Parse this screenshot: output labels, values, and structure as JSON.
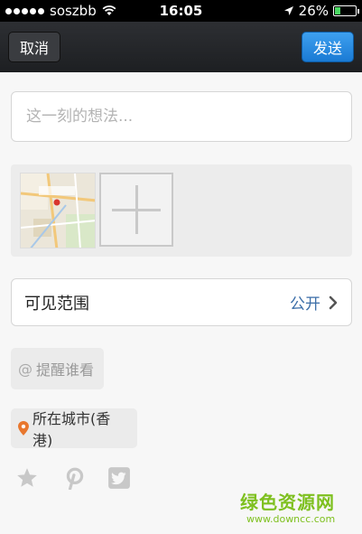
{
  "status_bar": {
    "carrier": "soszbb",
    "time": "16:05",
    "battery": "26%",
    "battery_level": 0.26,
    "battery_color": "#4cd964"
  },
  "nav": {
    "cancel_label": "取消",
    "send_label": "发送",
    "send_color": "#1a7ad4"
  },
  "compose": {
    "placeholder": "这一刻的想法..."
  },
  "photos": {
    "add_icon": "plus-icon",
    "map_icon": "map-thumbnail"
  },
  "visibility": {
    "label": "可见范围",
    "value": "公开",
    "icon": "chevron-right-icon"
  },
  "remind": {
    "icon": "at-icon",
    "label": "提醒谁看"
  },
  "location": {
    "icon": "location-pin-icon",
    "label": "所在城市(香港)",
    "pin_color": "#e8772e"
  },
  "share": {
    "icons": [
      "star-icon",
      "pinterest-icon",
      "twitter-icon"
    ]
  },
  "watermark": {
    "main": "绿色资源网",
    "sub": "www.downcc.com"
  }
}
